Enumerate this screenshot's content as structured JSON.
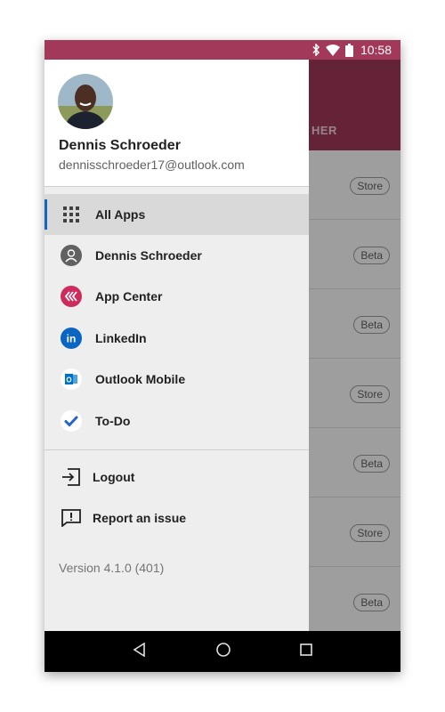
{
  "status_bar": {
    "time": "10:58"
  },
  "background_app": {
    "header_text": "HER",
    "rows": [
      {
        "badge": "Store"
      },
      {
        "badge": "Beta"
      },
      {
        "badge": "Beta"
      },
      {
        "badge": "Store"
      },
      {
        "badge": "Beta"
      },
      {
        "badge": "Store"
      },
      {
        "badge": "Beta"
      }
    ]
  },
  "profile": {
    "name": "Dennis Schroeder",
    "email": "dennisschroeder17@outlook.com"
  },
  "menu": {
    "apps": [
      {
        "label": "All Apps",
        "icon": "grid-icon",
        "selected": true
      },
      {
        "label": "Dennis Schroeder",
        "icon": "person-icon"
      },
      {
        "label": "App Center",
        "icon": "app-center-icon",
        "color": "#cc2d5e"
      },
      {
        "label": "LinkedIn",
        "icon": "linkedin-icon",
        "color": "#0a66c2"
      },
      {
        "label": "Outlook Mobile",
        "icon": "outlook-icon",
        "color": "#0072c6"
      },
      {
        "label": "To-Do",
        "icon": "todo-icon",
        "color": "#2564cf"
      }
    ],
    "actions": [
      {
        "label": "Logout",
        "icon": "logout-icon"
      },
      {
        "label": "Report an issue",
        "icon": "report-issue-icon"
      }
    ]
  },
  "version": "Version 4.1.0 (401)",
  "colors": {
    "brand": "#a3395a",
    "selected_indicator": "#1565c0"
  }
}
